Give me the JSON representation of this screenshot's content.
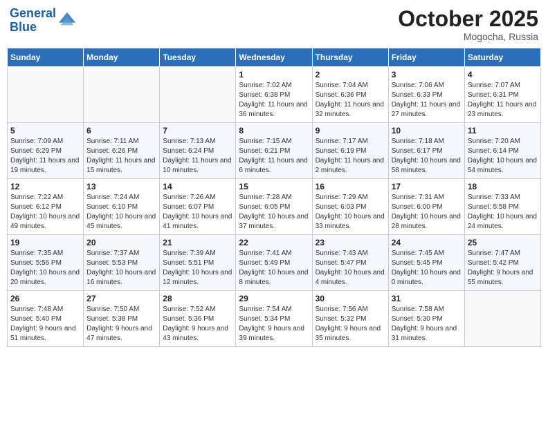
{
  "logo": {
    "line1": "General",
    "line2": "Blue"
  },
  "title": "October 2025",
  "location": "Mogocha, Russia",
  "weekdays": [
    "Sunday",
    "Monday",
    "Tuesday",
    "Wednesday",
    "Thursday",
    "Friday",
    "Saturday"
  ],
  "weeks": [
    [
      {
        "day": "",
        "info": ""
      },
      {
        "day": "",
        "info": ""
      },
      {
        "day": "",
        "info": ""
      },
      {
        "day": "1",
        "info": "Sunrise: 7:02 AM\nSunset: 6:38 PM\nDaylight: 11 hours and 36 minutes."
      },
      {
        "day": "2",
        "info": "Sunrise: 7:04 AM\nSunset: 6:36 PM\nDaylight: 11 hours and 32 minutes."
      },
      {
        "day": "3",
        "info": "Sunrise: 7:06 AM\nSunset: 6:33 PM\nDaylight: 11 hours and 27 minutes."
      },
      {
        "day": "4",
        "info": "Sunrise: 7:07 AM\nSunset: 6:31 PM\nDaylight: 11 hours and 23 minutes."
      }
    ],
    [
      {
        "day": "5",
        "info": "Sunrise: 7:09 AM\nSunset: 6:29 PM\nDaylight: 11 hours and 19 minutes."
      },
      {
        "day": "6",
        "info": "Sunrise: 7:11 AM\nSunset: 6:26 PM\nDaylight: 11 hours and 15 minutes."
      },
      {
        "day": "7",
        "info": "Sunrise: 7:13 AM\nSunset: 6:24 PM\nDaylight: 11 hours and 10 minutes."
      },
      {
        "day": "8",
        "info": "Sunrise: 7:15 AM\nSunset: 6:21 PM\nDaylight: 11 hours and 6 minutes."
      },
      {
        "day": "9",
        "info": "Sunrise: 7:17 AM\nSunset: 6:19 PM\nDaylight: 11 hours and 2 minutes."
      },
      {
        "day": "10",
        "info": "Sunrise: 7:18 AM\nSunset: 6:17 PM\nDaylight: 10 hours and 58 minutes."
      },
      {
        "day": "11",
        "info": "Sunrise: 7:20 AM\nSunset: 6:14 PM\nDaylight: 10 hours and 54 minutes."
      }
    ],
    [
      {
        "day": "12",
        "info": "Sunrise: 7:22 AM\nSunset: 6:12 PM\nDaylight: 10 hours and 49 minutes."
      },
      {
        "day": "13",
        "info": "Sunrise: 7:24 AM\nSunset: 6:10 PM\nDaylight: 10 hours and 45 minutes."
      },
      {
        "day": "14",
        "info": "Sunrise: 7:26 AM\nSunset: 6:07 PM\nDaylight: 10 hours and 41 minutes."
      },
      {
        "day": "15",
        "info": "Sunrise: 7:28 AM\nSunset: 6:05 PM\nDaylight: 10 hours and 37 minutes."
      },
      {
        "day": "16",
        "info": "Sunrise: 7:29 AM\nSunset: 6:03 PM\nDaylight: 10 hours and 33 minutes."
      },
      {
        "day": "17",
        "info": "Sunrise: 7:31 AM\nSunset: 6:00 PM\nDaylight: 10 hours and 28 minutes."
      },
      {
        "day": "18",
        "info": "Sunrise: 7:33 AM\nSunset: 5:58 PM\nDaylight: 10 hours and 24 minutes."
      }
    ],
    [
      {
        "day": "19",
        "info": "Sunrise: 7:35 AM\nSunset: 5:56 PM\nDaylight: 10 hours and 20 minutes."
      },
      {
        "day": "20",
        "info": "Sunrise: 7:37 AM\nSunset: 5:53 PM\nDaylight: 10 hours and 16 minutes."
      },
      {
        "day": "21",
        "info": "Sunrise: 7:39 AM\nSunset: 5:51 PM\nDaylight: 10 hours and 12 minutes."
      },
      {
        "day": "22",
        "info": "Sunrise: 7:41 AM\nSunset: 5:49 PM\nDaylight: 10 hours and 8 minutes."
      },
      {
        "day": "23",
        "info": "Sunrise: 7:43 AM\nSunset: 5:47 PM\nDaylight: 10 hours and 4 minutes."
      },
      {
        "day": "24",
        "info": "Sunrise: 7:45 AM\nSunset: 5:45 PM\nDaylight: 10 hours and 0 minutes."
      },
      {
        "day": "25",
        "info": "Sunrise: 7:47 AM\nSunset: 5:42 PM\nDaylight: 9 hours and 55 minutes."
      }
    ],
    [
      {
        "day": "26",
        "info": "Sunrise: 7:48 AM\nSunset: 5:40 PM\nDaylight: 9 hours and 51 minutes."
      },
      {
        "day": "27",
        "info": "Sunrise: 7:50 AM\nSunset: 5:38 PM\nDaylight: 9 hours and 47 minutes."
      },
      {
        "day": "28",
        "info": "Sunrise: 7:52 AM\nSunset: 5:36 PM\nDaylight: 9 hours and 43 minutes."
      },
      {
        "day": "29",
        "info": "Sunrise: 7:54 AM\nSunset: 5:34 PM\nDaylight: 9 hours and 39 minutes."
      },
      {
        "day": "30",
        "info": "Sunrise: 7:56 AM\nSunset: 5:32 PM\nDaylight: 9 hours and 35 minutes."
      },
      {
        "day": "31",
        "info": "Sunrise: 7:58 AM\nSunset: 5:30 PM\nDaylight: 9 hours and 31 minutes."
      },
      {
        "day": "",
        "info": ""
      }
    ]
  ]
}
